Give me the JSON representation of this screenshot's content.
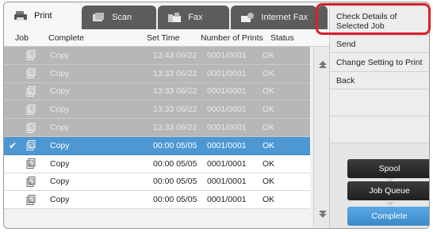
{
  "tabs": [
    {
      "label": "Print",
      "icon": "printer-icon",
      "active": true
    },
    {
      "label": "Scan",
      "icon": "scan-icon",
      "active": false
    },
    {
      "label": "Fax",
      "icon": "fax-icon",
      "active": false
    },
    {
      "label": "Internet Fax",
      "icon": "internet-fax-icon",
      "active": false
    }
  ],
  "header": {
    "job": "Job",
    "complete": "Complete",
    "set_time": "Set Time",
    "number_of_prints": "Number of Prints",
    "status": "Status"
  },
  "rows": [
    {
      "style": "grey",
      "checked": false,
      "name": "Copy",
      "set_time": "13:43 06/22",
      "prints": "0001/0001",
      "status": "OK"
    },
    {
      "style": "grey",
      "checked": false,
      "name": "Copy",
      "set_time": "13:33 06/22",
      "prints": "0001/0001",
      "status": "OK"
    },
    {
      "style": "grey",
      "checked": false,
      "name": "Copy",
      "set_time": "13:33 06/22",
      "prints": "0001/0001",
      "status": "OK"
    },
    {
      "style": "grey",
      "checked": false,
      "name": "Copy",
      "set_time": "13:33 06/22",
      "prints": "0001/0001",
      "status": "OK"
    },
    {
      "style": "grey",
      "checked": false,
      "name": "Copy",
      "set_time": "13:33 06/22",
      "prints": "0001/0001",
      "status": "OK"
    },
    {
      "style": "selected",
      "checked": true,
      "name": "Copy",
      "set_time": "00:00 05/05",
      "prints": "0001/0001",
      "status": "OK"
    },
    {
      "style": "normal",
      "checked": false,
      "name": "Copy",
      "set_time": "00:00 05/05",
      "prints": "0001/0001",
      "status": "OK"
    },
    {
      "style": "normal",
      "checked": false,
      "name": "Copy",
      "set_time": "00:00 05/05",
      "prints": "0001/0001",
      "status": "OK"
    },
    {
      "style": "normal",
      "checked": false,
      "name": "Copy",
      "set_time": "00:00 05/05",
      "prints": "0001/0001",
      "status": "OK"
    }
  ],
  "menu": {
    "check_details": "Check Details of Selected Job",
    "send": "Send",
    "change_setting": "Change Setting to Print",
    "back": "Back"
  },
  "buttons": {
    "spool": "Spool",
    "job_queue": "Job Queue",
    "complete": "Complete"
  },
  "colors": {
    "selected_row": "#4d98d3",
    "grey_row": "#b7b7b7",
    "highlight": "#d6202a",
    "active_button": "#4a9ad8"
  }
}
